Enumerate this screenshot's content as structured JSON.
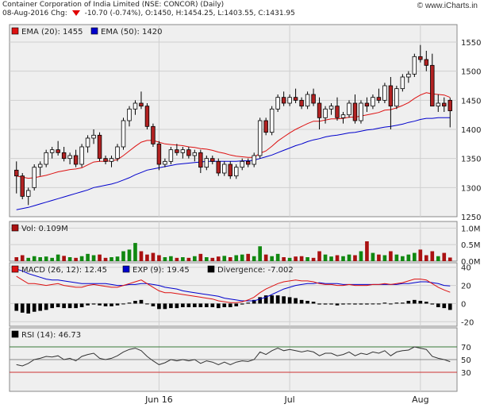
{
  "header": {
    "line1": "Container Corporation of India Limited (NSE: CONCOR) (Daily)",
    "line2_prefix": "08-Aug-2016 Chg:",
    "line2_change": "-10.70 (-0.74%), O:1450, H:1454.25, L:1403.55, C:1431.95",
    "watermark": "© www.iCharts.in"
  },
  "colors": {
    "up": "#ffffff",
    "down": "#b22222",
    "ema20": "#dd1111",
    "ema50": "#0000cc",
    "macd": "#dd1111",
    "signal": "#0000cc",
    "divergence": "#000000",
    "volume_up": "#118811",
    "volume_down": "#aa1111",
    "rsi": "#333333",
    "panel_bg": "#efefef",
    "grid": "#cfcfcf"
  },
  "chart_data": [
    {
      "type": "candlestick",
      "legend": [
        {
          "label": "EMA (20): 1455",
          "color": "#dd1111"
        },
        {
          "label": "EMA (50): 1420",
          "color": "#0000cc"
        }
      ],
      "ylim": [
        1250,
        1580
      ],
      "y_ticks": [
        "1550",
        "1500",
        "1450",
        "1400",
        "1350",
        "1300",
        "1250"
      ],
      "candles": [
        [
          1330,
          1345,
          1290,
          1320
        ],
        [
          1320,
          1325,
          1280,
          1285
        ],
        [
          1285,
          1300,
          1270,
          1295
        ],
        [
          1300,
          1340,
          1295,
          1335
        ],
        [
          1335,
          1345,
          1320,
          1340
        ],
        [
          1340,
          1365,
          1335,
          1360
        ],
        [
          1360,
          1370,
          1350,
          1365
        ],
        [
          1365,
          1380,
          1355,
          1360
        ],
        [
          1360,
          1370,
          1345,
          1350
        ],
        [
          1350,
          1360,
          1340,
          1355
        ],
        [
          1355,
          1365,
          1335,
          1340
        ],
        [
          1340,
          1375,
          1335,
          1370
        ],
        [
          1370,
          1390,
          1360,
          1385
        ],
        [
          1385,
          1400,
          1375,
          1390
        ],
        [
          1390,
          1395,
          1345,
          1350
        ],
        [
          1350,
          1355,
          1340,
          1345
        ],
        [
          1345,
          1355,
          1335,
          1350
        ],
        [
          1350,
          1375,
          1345,
          1370
        ],
        [
          1370,
          1420,
          1365,
          1415
        ],
        [
          1415,
          1440,
          1405,
          1435
        ],
        [
          1435,
          1450,
          1425,
          1445
        ],
        [
          1445,
          1465,
          1435,
          1440
        ],
        [
          1440,
          1445,
          1400,
          1405
        ],
        [
          1405,
          1410,
          1370,
          1375
        ],
        [
          1375,
          1380,
          1330,
          1340
        ],
        [
          1340,
          1350,
          1335,
          1345
        ],
        [
          1345,
          1370,
          1340,
          1365
        ],
        [
          1365,
          1375,
          1355,
          1360
        ],
        [
          1360,
          1370,
          1350,
          1365
        ],
        [
          1365,
          1370,
          1350,
          1355
        ],
        [
          1355,
          1365,
          1345,
          1360
        ],
        [
          1360,
          1365,
          1325,
          1335
        ],
        [
          1335,
          1355,
          1330,
          1350
        ],
        [
          1350,
          1355,
          1340,
          1345
        ],
        [
          1345,
          1350,
          1320,
          1325
        ],
        [
          1325,
          1345,
          1320,
          1340
        ],
        [
          1340,
          1345,
          1315,
          1320
        ],
        [
          1320,
          1340,
          1315,
          1335
        ],
        [
          1335,
          1350,
          1330,
          1345
        ],
        [
          1345,
          1350,
          1335,
          1340
        ],
        [
          1340,
          1360,
          1335,
          1355
        ],
        [
          1355,
          1420,
          1350,
          1415
        ],
        [
          1415,
          1420,
          1390,
          1395
        ],
        [
          1395,
          1440,
          1390,
          1435
        ],
        [
          1435,
          1460,
          1430,
          1455
        ],
        [
          1455,
          1465,
          1440,
          1445
        ],
        [
          1445,
          1460,
          1440,
          1455
        ],
        [
          1455,
          1470,
          1445,
          1450
        ],
        [
          1450,
          1455,
          1435,
          1440
        ],
        [
          1440,
          1465,
          1435,
          1460
        ],
        [
          1460,
          1470,
          1440,
          1445
        ],
        [
          1445,
          1455,
          1400,
          1420
        ],
        [
          1420,
          1440,
          1410,
          1435
        ],
        [
          1435,
          1445,
          1425,
          1440
        ],
        [
          1440,
          1455,
          1415,
          1420
        ],
        [
          1420,
          1430,
          1410,
          1425
        ],
        [
          1425,
          1450,
          1420,
          1445
        ],
        [
          1445,
          1460,
          1410,
          1415
        ],
        [
          1415,
          1450,
          1410,
          1445
        ],
        [
          1445,
          1455,
          1430,
          1440
        ],
        [
          1440,
          1460,
          1435,
          1455
        ],
        [
          1455,
          1470,
          1445,
          1450
        ],
        [
          1450,
          1480,
          1445,
          1475
        ],
        [
          1475,
          1490,
          1400,
          1440
        ],
        [
          1440,
          1475,
          1435,
          1470
        ],
        [
          1470,
          1495,
          1465,
          1490
        ],
        [
          1490,
          1500,
          1480,
          1495
        ],
        [
          1495,
          1530,
          1490,
          1525
        ],
        [
          1525,
          1545,
          1515,
          1520
        ],
        [
          1520,
          1535,
          1500,
          1510
        ],
        [
          1510,
          1530,
          1440,
          1440
        ],
        [
          1440,
          1460,
          1430,
          1445
        ],
        [
          1445,
          1455,
          1430,
          1440
        ],
        [
          1450,
          1454.25,
          1403.55,
          1431.95
        ]
      ],
      "ema20": [
        1320,
        1318,
        1316,
        1317,
        1319,
        1321,
        1324,
        1327,
        1329,
        1331,
        1332,
        1334,
        1339,
        1344,
        1345,
        1345,
        1346,
        1348,
        1355,
        1363,
        1371,
        1378,
        1381,
        1381,
        1378,
        1375,
        1374,
        1373,
        1372,
        1370,
        1369,
        1367,
        1366,
        1364,
        1361,
        1359,
        1356,
        1354,
        1353,
        1352,
        1352,
        1359,
        1363,
        1371,
        1380,
        1387,
        1394,
        1400,
        1405,
        1410,
        1414,
        1414,
        1416,
        1418,
        1418,
        1419,
        1421,
        1421,
        1423,
        1425,
        1427,
        1429,
        1433,
        1434,
        1437,
        1441,
        1446,
        1453,
        1459,
        1463,
        1461,
        1460,
        1459,
        1455
      ],
      "ema50": [
        1262,
        1264,
        1266,
        1269,
        1272,
        1275,
        1278,
        1281,
        1284,
        1287,
        1290,
        1293,
        1296,
        1300,
        1302,
        1304,
        1306,
        1309,
        1313,
        1317,
        1322,
        1326,
        1330,
        1332,
        1334,
        1336,
        1338,
        1340,
        1341,
        1342,
        1343,
        1344,
        1345,
        1345,
        1345,
        1345,
        1345,
        1345,
        1346,
        1346,
        1347,
        1350,
        1353,
        1356,
        1360,
        1364,
        1368,
        1372,
        1375,
        1379,
        1382,
        1384,
        1387,
        1389,
        1390,
        1392,
        1394,
        1395,
        1397,
        1399,
        1400,
        1402,
        1404,
        1405,
        1407,
        1409,
        1412,
        1414,
        1417,
        1419,
        1419,
        1420,
        1420,
        1420
      ]
    },
    {
      "type": "bar",
      "legend": [
        {
          "label": "Vol: 0.109M",
          "color": "#aa1111"
        }
      ],
      "ylim": [
        0,
        1.2
      ],
      "y_ticks": [
        "1.0M",
        "0.5M",
        "0.0M"
      ],
      "values": [
        0.12,
        0.18,
        0.1,
        0.15,
        0.12,
        0.14,
        0.1,
        0.2,
        0.16,
        0.12,
        0.1,
        0.15,
        0.22,
        0.18,
        0.2,
        0.1,
        0.12,
        0.14,
        0.3,
        0.35,
        0.55,
        0.3,
        0.2,
        0.25,
        0.18,
        0.12,
        0.15,
        0.1,
        0.12,
        0.1,
        0.15,
        0.22,
        0.12,
        0.1,
        0.14,
        0.16,
        0.12,
        0.18,
        0.2,
        0.22,
        0.15,
        0.45,
        0.2,
        0.15,
        0.22,
        0.12,
        0.1,
        0.14,
        0.15,
        0.12,
        0.1,
        0.3,
        0.2,
        0.14,
        0.18,
        0.15,
        0.2,
        0.18,
        0.3,
        0.6,
        0.25,
        0.2,
        0.18,
        0.3,
        0.2,
        0.15,
        0.2,
        0.25,
        0.35,
        0.18,
        0.3,
        0.15,
        0.25,
        0.109
      ],
      "up": [
        false,
        false,
        true,
        true,
        true,
        true,
        true,
        true,
        false,
        true,
        false,
        true,
        true,
        true,
        false,
        false,
        true,
        true,
        true,
        true,
        true,
        false,
        false,
        false,
        false,
        true,
        true,
        false,
        true,
        false,
        true,
        false,
        true,
        false,
        false,
        true,
        false,
        true,
        true,
        false,
        true,
        true,
        false,
        true,
        true,
        false,
        true,
        false,
        false,
        true,
        false,
        false,
        true,
        true,
        false,
        true,
        true,
        false,
        true,
        false,
        true,
        false,
        true,
        false,
        true,
        true,
        true,
        true,
        false,
        false,
        false,
        true,
        false,
        false
      ]
    },
    {
      "type": "line",
      "legend": [
        {
          "label": "MACD (26, 12): 12.45",
          "color": "#dd1111"
        },
        {
          "label": "EXP (9): 19.45",
          "color": "#0000cc"
        },
        {
          "label": "Divergence: -7.002",
          "color": "#000000"
        }
      ],
      "ylim": [
        -25,
        45
      ],
      "y_ticks": [
        "40",
        "20",
        "0",
        "-20"
      ],
      "macd": [
        30,
        26,
        22,
        22,
        21,
        20,
        21,
        22,
        20,
        19,
        18,
        18,
        20,
        21,
        20,
        19,
        18,
        18,
        20,
        22,
        24,
        26,
        22,
        18,
        14,
        12,
        12,
        11,
        10,
        9,
        8,
        7,
        6,
        5,
        3,
        2,
        1,
        1,
        2,
        4,
        7,
        12,
        16,
        19,
        22,
        24,
        25,
        26,
        25,
        25,
        24,
        22,
        21,
        21,
        20,
        20,
        21,
        20,
        20,
        20,
        21,
        21,
        22,
        21,
        22,
        23,
        25,
        27,
        27,
        26,
        22,
        18,
        15,
        12.45
      ],
      "signal": [
        38,
        36,
        33,
        31,
        29,
        27,
        26,
        26,
        25,
        24,
        23,
        22,
        22,
        22,
        22,
        22,
        21,
        20,
        20,
        21,
        21,
        22,
        22,
        21,
        20,
        18,
        17,
        16,
        14,
        13,
        12,
        11,
        10,
        9,
        8,
        6,
        5,
        4,
        3,
        3,
        3,
        5,
        7,
        10,
        13,
        16,
        18,
        20,
        21,
        22,
        22,
        23,
        22,
        22,
        22,
        21,
        21,
        21,
        21,
        21,
        21,
        21,
        21,
        21,
        21,
        22,
        22,
        23,
        24,
        24,
        23,
        22,
        20,
        19.45
      ],
      "divergence": [
        -8,
        -10,
        -11,
        -9,
        -8,
        -7,
        -5,
        -4,
        -5,
        -5,
        -5,
        -4,
        -2,
        -1,
        -2,
        -3,
        -3,
        -2,
        0,
        1,
        3,
        4,
        0,
        -3,
        -6,
        -6,
        -5,
        -5,
        -4,
        -4,
        -4,
        -4,
        -4,
        -4,
        -5,
        -4,
        -4,
        -3,
        -1,
        1,
        4,
        7,
        9,
        9,
        9,
        8,
        7,
        6,
        4,
        3,
        2,
        -1,
        -1,
        -1,
        -2,
        -1,
        0,
        -1,
        -1,
        -1,
        0,
        0,
        1,
        0,
        1,
        1,
        3,
        4,
        3,
        2,
        -1,
        -4,
        -5,
        -7
      ]
    },
    {
      "type": "line",
      "legend": [
        {
          "label": "RSI (14): 46.73",
          "color": "#000000"
        }
      ],
      "ylim": [
        0,
        100
      ],
      "y_ticks": [
        "70",
        "50",
        "30"
      ],
      "values": [
        42,
        40,
        44,
        50,
        52,
        55,
        54,
        56,
        50,
        52,
        48,
        55,
        58,
        60,
        52,
        50,
        52,
        56,
        62,
        66,
        68,
        64,
        55,
        48,
        42,
        45,
        50,
        48,
        50,
        48,
        50,
        44,
        48,
        46,
        42,
        46,
        42,
        46,
        48,
        47,
        50,
        62,
        58,
        64,
        68,
        64,
        66,
        64,
        62,
        64,
        62,
        56,
        60,
        60,
        56,
        58,
        62,
        56,
        60,
        58,
        62,
        60,
        64,
        56,
        62,
        64,
        65,
        70,
        68,
        66,
        55,
        52,
        50,
        46.73
      ]
    }
  ],
  "x_labels": [
    {
      "label": "Jun 16",
      "index": 24
    },
    {
      "label": "Jul",
      "index": 46
    },
    {
      "label": "Aug",
      "index": 68
    }
  ]
}
